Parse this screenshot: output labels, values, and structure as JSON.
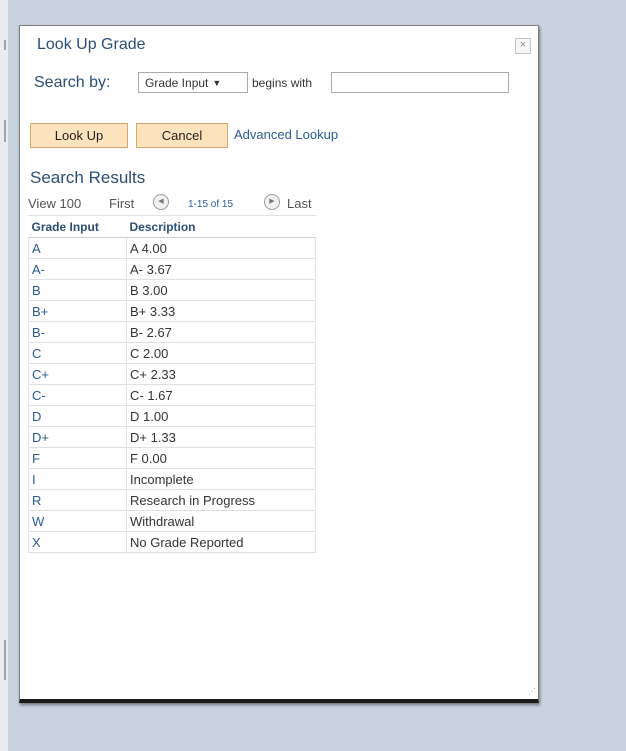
{
  "modal": {
    "title": "Look Up Grade",
    "close_label": "×"
  },
  "search": {
    "label": "Search by:",
    "field_selected": "Grade Input",
    "operator": "begins with",
    "value": ""
  },
  "buttons": {
    "lookup_label": "Look Up",
    "cancel_label": "Cancel",
    "advanced_label": "Advanced Lookup"
  },
  "results": {
    "title": "Search Results",
    "nav": {
      "view_all": "View 100",
      "first": "First",
      "range": "1-15 of 15",
      "last": "Last"
    },
    "columns": [
      "Grade Input",
      "Description"
    ],
    "rows": [
      [
        "A",
        "A 4.00"
      ],
      [
        "A-",
        "A- 3.67"
      ],
      [
        "B",
        "B 3.00"
      ],
      [
        "B+",
        "B+ 3.33"
      ],
      [
        "B-",
        "B- 2.67"
      ],
      [
        "C",
        "C 2.00"
      ],
      [
        "C+",
        "C+ 2.33"
      ],
      [
        "C-",
        "C- 1.67"
      ],
      [
        "D",
        "D 1.00"
      ],
      [
        "D+",
        "D+ 1.33"
      ],
      [
        "F",
        "F 0.00"
      ],
      [
        "I",
        "Incomplete"
      ],
      [
        "R",
        "Research in Progress"
      ],
      [
        "W",
        "Withdrawal"
      ],
      [
        "X",
        "No Grade Reported"
      ]
    ]
  },
  "colors": {
    "title": "#2b4f77",
    "link": "#2b5a93",
    "button_bg": "#fce3bd",
    "backdrop": "#c9d3dd"
  }
}
